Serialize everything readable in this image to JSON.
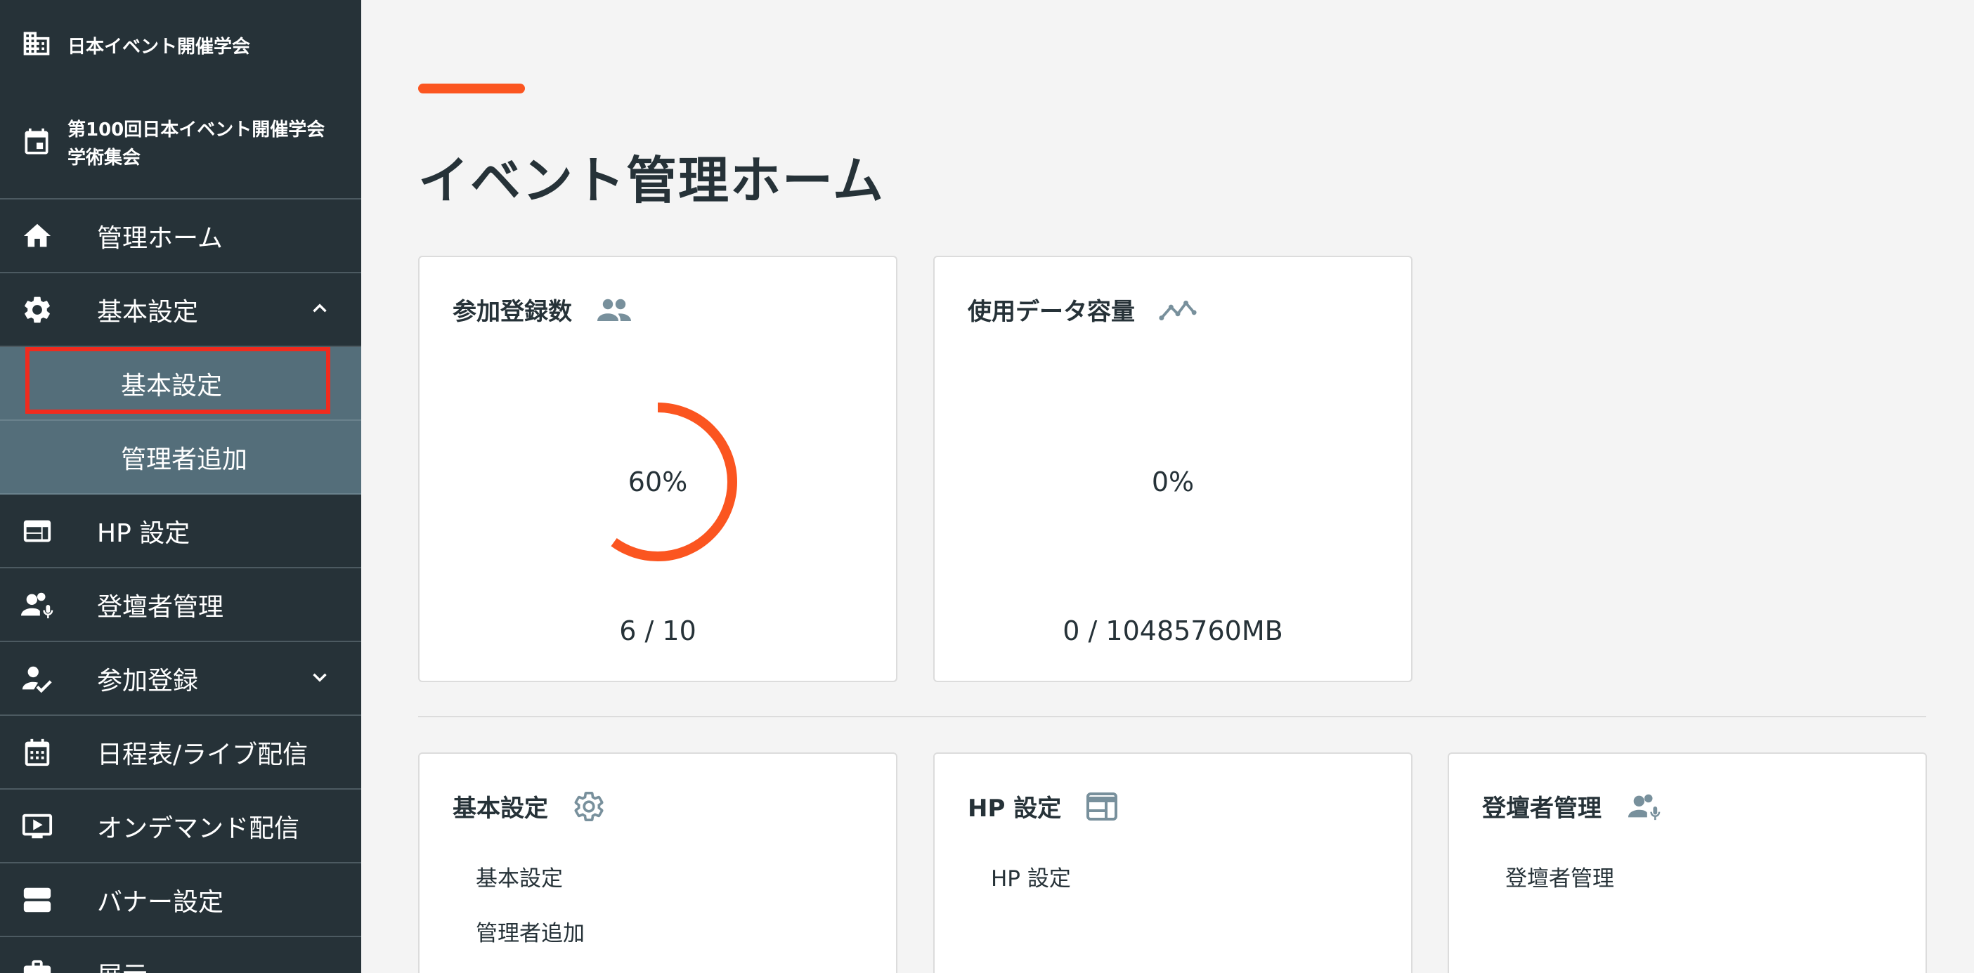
{
  "sidebar": {
    "org_name": "日本イベント開催学会",
    "event_name_line1": "第100回日本イベント開催学会",
    "event_name_line2": "学術集会",
    "items": [
      {
        "label": "管理ホーム",
        "icon": "home-icon"
      },
      {
        "label": "基本設定",
        "icon": "gear-icon",
        "expanded": true
      },
      {
        "label": "HP 設定",
        "icon": "web-layout-icon"
      },
      {
        "label": "登壇者管理",
        "icon": "speaker-icon"
      },
      {
        "label": "参加登録",
        "icon": "person-check-icon",
        "expanded": false
      },
      {
        "label": "日程表/ライブ配信",
        "icon": "calendar-icon"
      },
      {
        "label": "オンデマンド配信",
        "icon": "video-icon"
      },
      {
        "label": "バナー設定",
        "icon": "banner-icon"
      },
      {
        "label": "展示",
        "icon": "briefcase-icon"
      }
    ],
    "sub_items": [
      {
        "label": "基本設定",
        "active": true
      },
      {
        "label": "管理者追加",
        "active": false
      }
    ]
  },
  "main": {
    "title": "イベント管理ホーム",
    "accent_color": "#fb5520",
    "stats": [
      {
        "title": "参加登録数",
        "icon": "people-icon",
        "percent": 60,
        "percent_label": "60%",
        "counts": "6 / 10"
      },
      {
        "title": "使用データ容量",
        "icon": "trend-line-icon",
        "percent": 0,
        "percent_label": "0%",
        "counts": "0 / 10485760MB"
      }
    ],
    "sections": [
      {
        "title": "基本設定",
        "icon": "gear-icon",
        "links": [
          "基本設定",
          "管理者追加"
        ]
      },
      {
        "title": "HP 設定",
        "icon": "web-layout-icon",
        "links": [
          "HP 設定"
        ]
      },
      {
        "title": "登壇者管理",
        "icon": "speaker-icon",
        "links": [
          "登壇者管理"
        ]
      }
    ]
  }
}
